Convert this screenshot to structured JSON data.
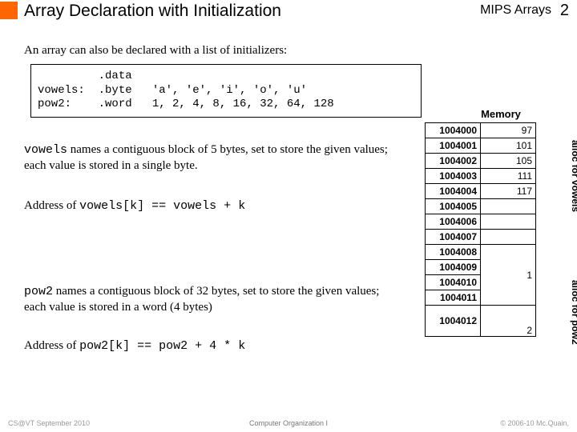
{
  "header": {
    "title": "Array Declaration with Initialization",
    "section": "MIPS Arrays",
    "page": "2"
  },
  "intro": "An array can also be declared with a list of initializers:",
  "code": "         .data\nvowels:  .byte   'a', 'e', 'i', 'o', 'u'\npow2:    .word   1, 2, 4, 8, 16, 32, 64, 128",
  "para1_pre": "vowels",
  "para1_rest": " names a contiguous block of 5 bytes, set to store the given values; each value is stored in a single byte.",
  "para2_pre": "Address of ",
  "para2_code": "vowels[k] == vowels + k",
  "para3_pre": "pow2",
  "para3_rest": " names a contiguous block of 32 bytes, set to store the given values; each value is stored in a word (4 bytes)",
  "para4_pre": "Address of ",
  "para4_code": "pow2[k] == pow2 + 4 * k",
  "memory": {
    "title": "Memory",
    "rows": [
      {
        "addr": "1004000",
        "val": "97"
      },
      {
        "addr": "1004001",
        "val": "101"
      },
      {
        "addr": "1004002",
        "val": "105"
      },
      {
        "addr": "1004003",
        "val": "111"
      },
      {
        "addr": "1004004",
        "val": "117"
      },
      {
        "addr": "1004005",
        "val": ""
      },
      {
        "addr": "1004006",
        "val": ""
      },
      {
        "addr": "1004007",
        "val": ""
      },
      {
        "addr": "1004008",
        "val": ""
      },
      {
        "addr": "1004009",
        "val": ""
      },
      {
        "addr": "1004010",
        "val": ""
      },
      {
        "addr": "1004011",
        "val": ""
      },
      {
        "addr": "1004012",
        "val": ""
      }
    ],
    "merged_vals": {
      "start9": "1",
      "after12": "2"
    },
    "label_vowels": "alloc for vowels",
    "label_pow2": "alloc for pow2"
  },
  "footer": {
    "left": "CS@VT September 2010",
    "mid": "Computer Organization I",
    "right": "© 2006-10  Mc.Quain,"
  }
}
